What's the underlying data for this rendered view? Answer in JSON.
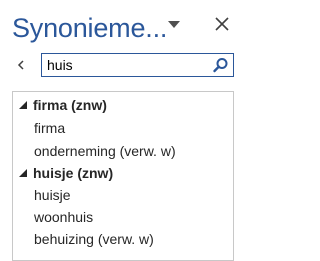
{
  "pane": {
    "title": "Synonieme...",
    "options_icon": "chevron-down-icon",
    "close_icon": "close-icon"
  },
  "search": {
    "back_icon": "chevron-left-icon",
    "value": "huis",
    "search_icon": "search-icon"
  },
  "results": {
    "groups": [
      {
        "label": "firma (znw)",
        "items": [
          "firma",
          "onderneming (verw. w)"
        ]
      },
      {
        "label": "huisje (znw)",
        "items": [
          "huisje",
          "woonhuis",
          "behuizing (verw. w)"
        ]
      }
    ]
  },
  "colors": {
    "title": "#2b579a",
    "search_border": "#2b579a",
    "list_border": "#c8c8c8",
    "text": "#262626"
  }
}
